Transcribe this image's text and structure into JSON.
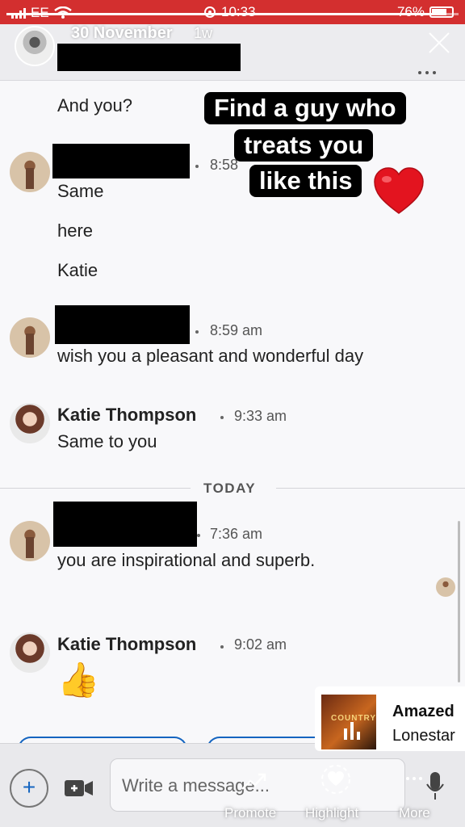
{
  "status_bar": {
    "carrier": "EE",
    "time": "10:33",
    "battery": "76%"
  },
  "story": {
    "date": "30 November",
    "age": "1w",
    "progress": 0.95
  },
  "messages": [
    {
      "id": "m1",
      "text": "And you?"
    },
    {
      "id": "m2",
      "time": "8:58",
      "lines": [
        "Same",
        "here",
        "Katie"
      ]
    },
    {
      "id": "m3",
      "time": "8:59 am",
      "text": "wish you a pleasant and wonderful day"
    },
    {
      "id": "m4",
      "sender": "Katie Thompson",
      "time": "9:33 am",
      "text": "Same to you"
    },
    {
      "id": "m5",
      "time": "7:36 am",
      "text": "you are inspirational and superb."
    },
    {
      "id": "m6",
      "sender": "Katie Thompson",
      "time": "9:02 am",
      "text": "👍"
    }
  ],
  "divider": {
    "label": "TODAY"
  },
  "sticker": {
    "line1": "Find a guy who",
    "line2": "treats you",
    "line3": "like this"
  },
  "composer": {
    "placeholder": "Write a message..."
  },
  "story_actions": {
    "promote": "Promote",
    "highlight": "Highlight",
    "more": "More"
  },
  "music": {
    "title": "Amazed",
    "artist": "Lonestar",
    "album_text": "COUNTRY"
  },
  "colors": {
    "status_bar": "#d32f2f",
    "accent": "#1565c0"
  }
}
